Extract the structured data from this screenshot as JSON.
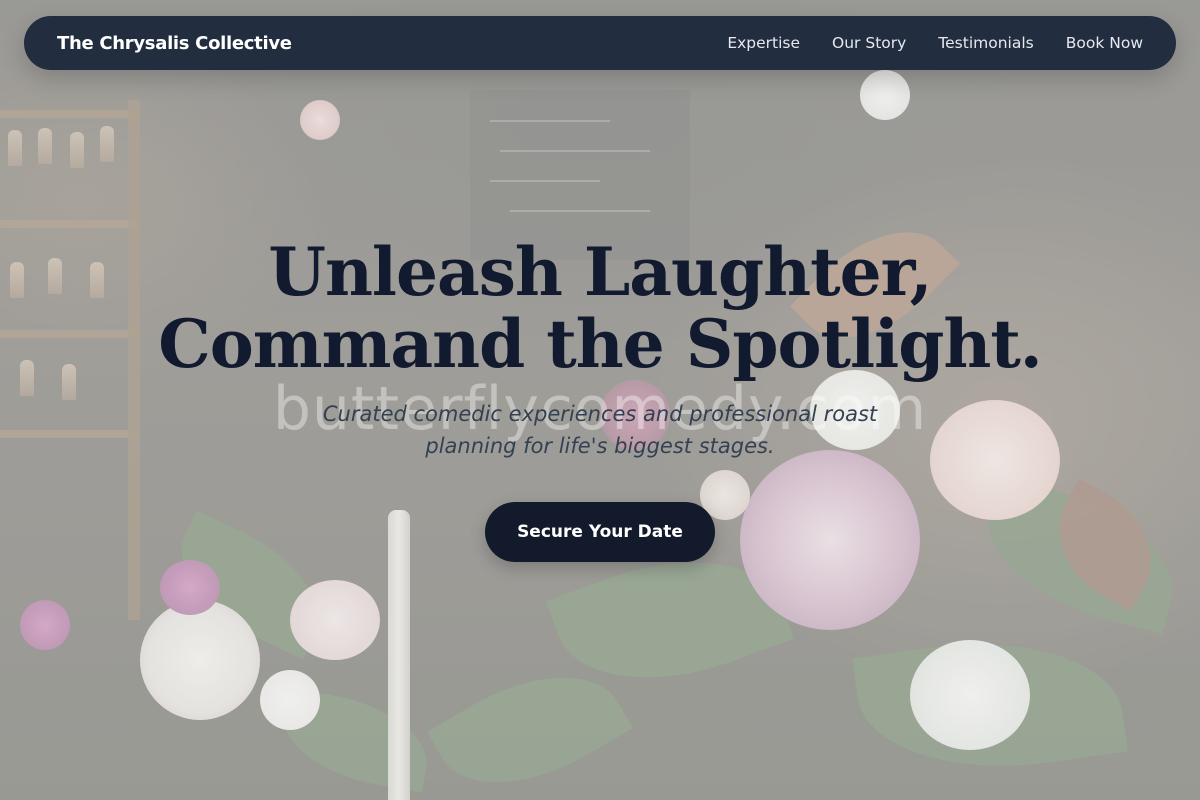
{
  "nav": {
    "brand": "The Chrysalis Collective",
    "links": [
      {
        "label": "Expertise"
      },
      {
        "label": "Our Story"
      },
      {
        "label": "Testimonials"
      },
      {
        "label": "Book Now"
      }
    ]
  },
  "hero": {
    "title_line1": "Unleash Laughter,",
    "title_line2": "Command the Spotlight.",
    "subtitle": "Curated comedic experiences and professional roast planning for life's biggest stages.",
    "cta_label": "Secure Your Date",
    "watermark": "butterflycomedy.com"
  },
  "colors": {
    "nav_background": "#222d3f",
    "title": "#111a2e",
    "subtitle": "#344153",
    "cta_background": "#121a2c"
  }
}
